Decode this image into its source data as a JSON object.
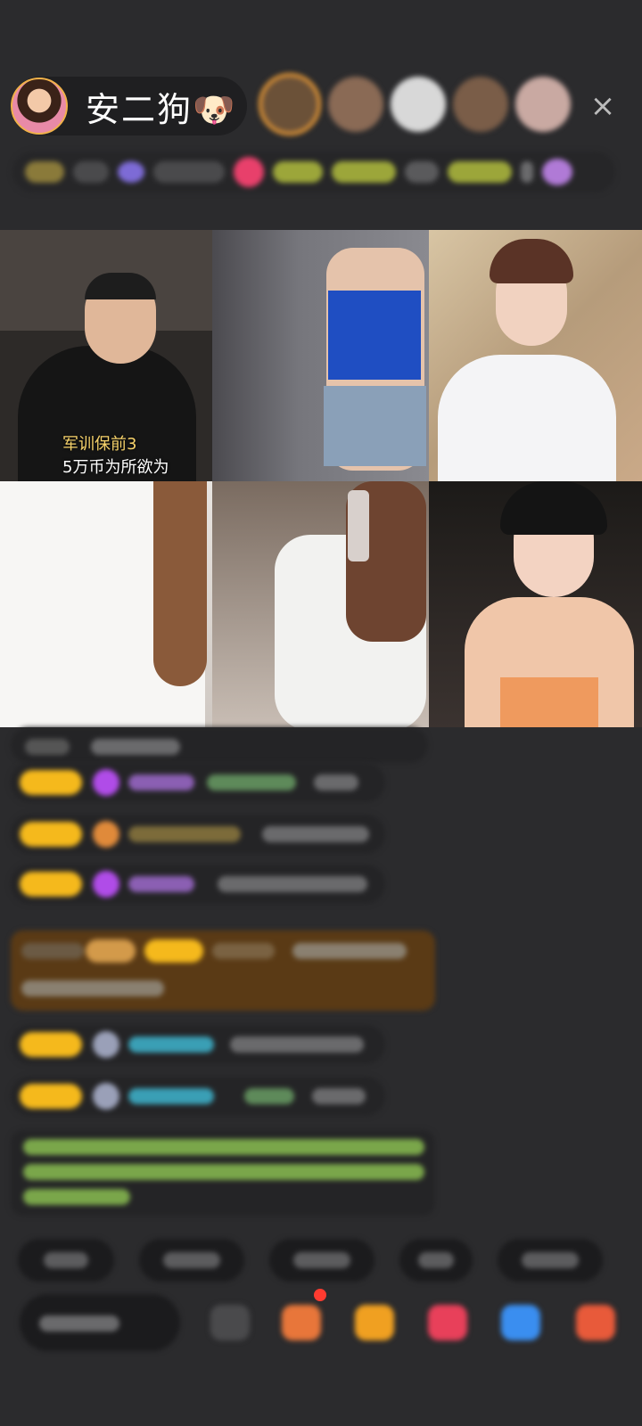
{
  "header": {
    "host_name": "安二狗🐶",
    "close_symbol": "×",
    "viewer_count_visible": 5
  },
  "video_grid": {
    "tile_count": 6,
    "tile1_caption": [
      "军训保前3",
      "5万币为所欲为"
    ]
  },
  "colors": {
    "badge": "#f5b91c",
    "gem_purple": "#b04ce8",
    "username_cyan": "#3a9fb5",
    "system_green": "#8cc63f",
    "announce_bg": "#5a3a15"
  },
  "chat": {
    "message_count": 7
  },
  "quick_replies_count": 5,
  "bottom_bar": {
    "input_icon": "chat-input",
    "icons": [
      "more-icon",
      "gift-box-icon",
      "red-packet-icon",
      "fan-club-icon",
      "game-icon",
      "gift-icon"
    ]
  }
}
